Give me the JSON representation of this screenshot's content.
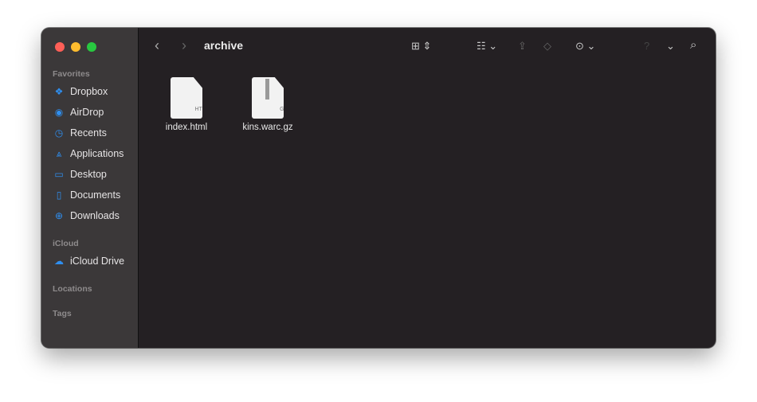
{
  "window": {
    "title": "archive"
  },
  "sidebar": {
    "sections": [
      {
        "label": "Favorites",
        "items": [
          {
            "label": "Dropbox",
            "icon": "dropbox-icon"
          },
          {
            "label": "AirDrop",
            "icon": "airdrop-icon"
          },
          {
            "label": "Recents",
            "icon": "clock-icon"
          },
          {
            "label": "Applications",
            "icon": "applications-icon"
          },
          {
            "label": "Desktop",
            "icon": "desktop-icon"
          },
          {
            "label": "Documents",
            "icon": "document-icon"
          },
          {
            "label": "Downloads",
            "icon": "download-icon"
          }
        ]
      },
      {
        "label": "iCloud",
        "items": [
          {
            "label": "iCloud Drive",
            "icon": "cloud-icon"
          }
        ]
      },
      {
        "label": "Locations",
        "items": []
      },
      {
        "label": "Tags",
        "items": []
      }
    ]
  },
  "files": [
    {
      "name": "index.html",
      "type_label": "HTML"
    },
    {
      "name": "kins.warc.gz",
      "type_label": "GZ"
    }
  ],
  "colors": {
    "accent": "#2f8ff0",
    "close": "#ff5f57",
    "minimize": "#febc2e",
    "zoom": "#28c840"
  }
}
